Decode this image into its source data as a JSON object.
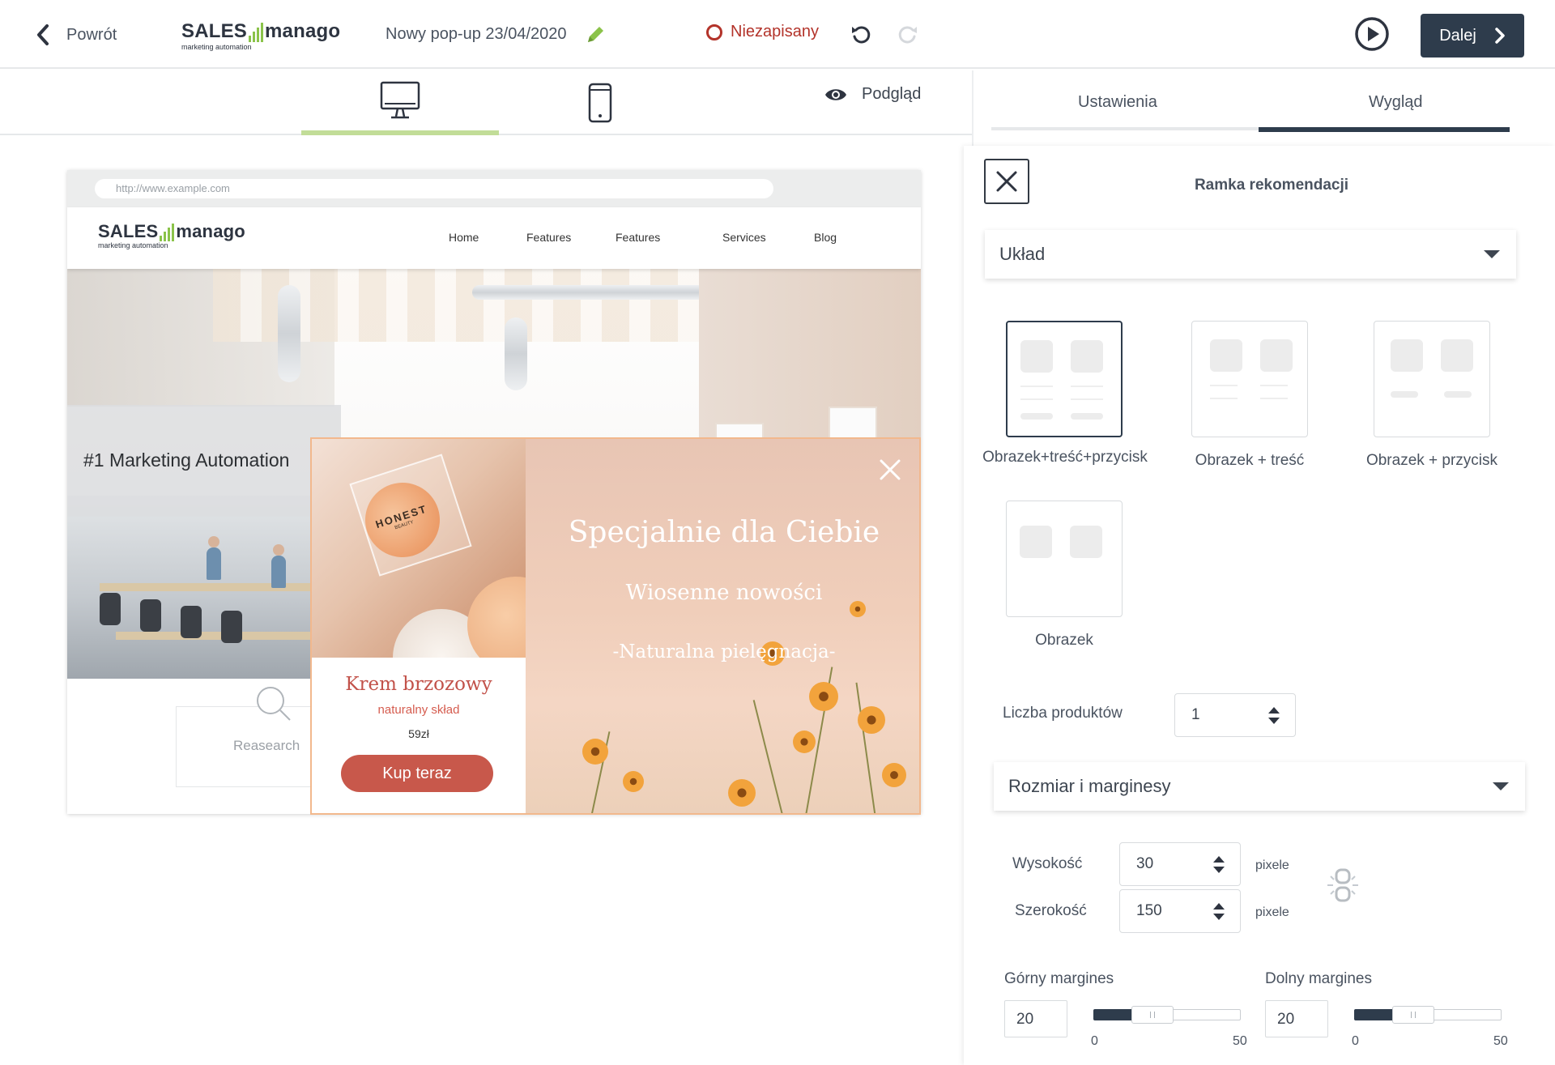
{
  "topbar": {
    "back_label": "Powrót",
    "logo": {
      "left": "SALES",
      "right": "manago",
      "sub": "marketing automation"
    },
    "doc_title": "Nowy pop-up 23/04/2020",
    "status_label": "Niezapisany",
    "next_label": "Dalej"
  },
  "devices": {
    "active": "desktop",
    "preview_label": "Podgląd"
  },
  "site": {
    "url": "http://www.example.com",
    "logo": {
      "left": "SALES",
      "right": "manago",
      "sub": "marketing automation"
    },
    "nav": [
      "Home",
      "Features",
      "Features",
      "Services",
      "Blog"
    ],
    "tagline": "#1 Marketing Automation",
    "research_label": "Reasearch"
  },
  "popup": {
    "product_brand": "HONEST",
    "product_brand_sub": "BEAUTY",
    "product_name": "Krem brzozowy",
    "product_desc": "naturalny skład",
    "product_price": "59zł",
    "buy_label": "Kup teraz",
    "title": "Specjalnie dla Ciebie",
    "subtitle": "Wiosenne nowości",
    "subtitle2": "-Naturalna pielęgnacja-"
  },
  "panel": {
    "tabs": [
      "Ustawienia",
      "Wygląd"
    ],
    "active_tab": "Wygląd",
    "title": "Ramka rekomendacji",
    "layout_section": "Układ",
    "layouts": [
      {
        "label": "Obrazek+treść+przycisk",
        "selected": true
      },
      {
        "label": "Obrazek + treść",
        "selected": false
      },
      {
        "label": "Obrazek + przycisk",
        "selected": false
      },
      {
        "label": "Obrazek",
        "selected": false
      }
    ],
    "product_count_label": "Liczba produktów",
    "product_count": "1",
    "size_section": "Rozmiar i marginesy",
    "height_label": "Wysokość",
    "height_value": "30",
    "width_label": "Szerokość",
    "width_value": "150",
    "unit_label": "pixele",
    "top_margin": {
      "label": "Górny margines",
      "value": "20",
      "min": "0",
      "max": "50",
      "fraction": 0.4
    },
    "bottom_margin": {
      "label": "Dolny margines",
      "value": "20",
      "min": "0",
      "max": "50",
      "fraction": 0.4
    }
  },
  "colors": {
    "accent_dark": "#2e3c4c",
    "status_red": "#b3332a",
    "logo_green": "#8bc34a",
    "buy_button": "#c8584b",
    "popup_border": "#f2b88d"
  },
  "icons": [
    "chevron-left-icon",
    "pencil-icon",
    "undo-icon",
    "redo-icon",
    "play-icon",
    "chevron-right-icon",
    "desktop-icon",
    "mobile-icon",
    "eye-icon",
    "close-icon",
    "search-icon",
    "link-icon"
  ]
}
